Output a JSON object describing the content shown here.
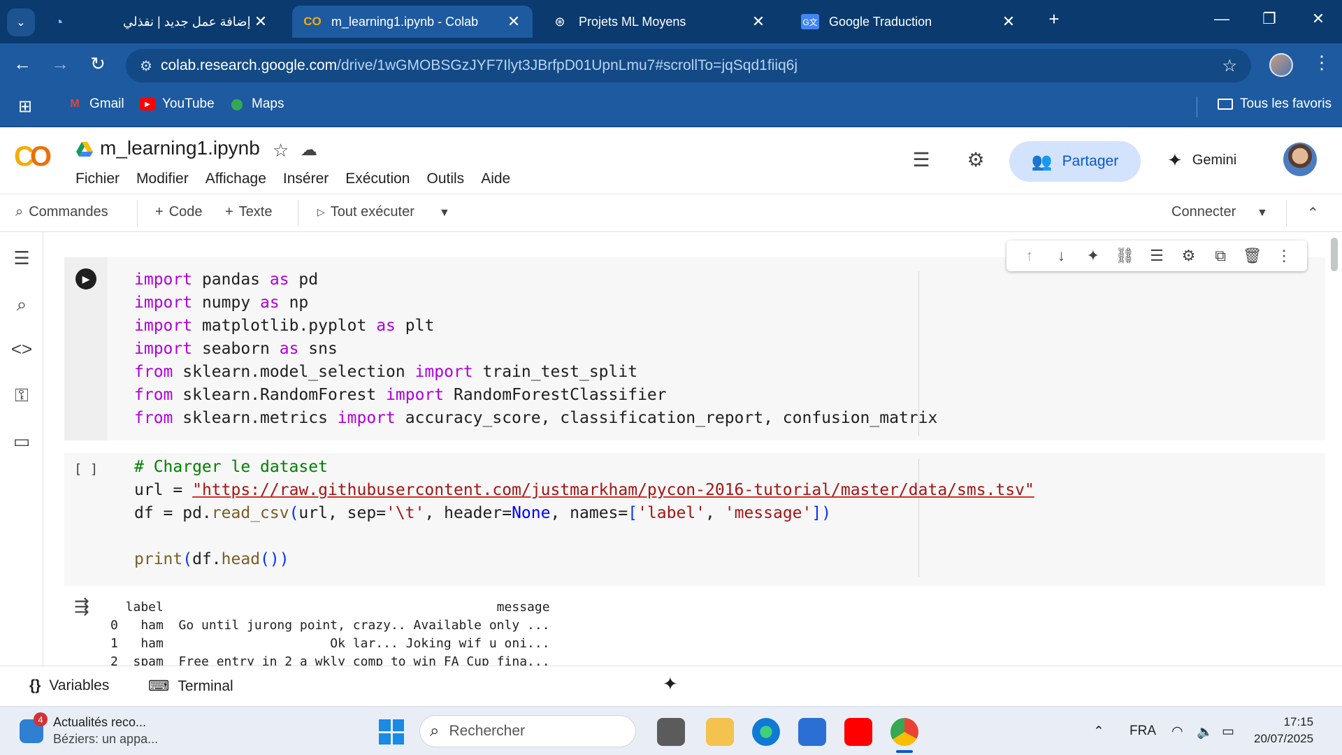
{
  "browser": {
    "tabs": [
      {
        "title": "إضافة عمل جديد | نفذلي",
        "active": false
      },
      {
        "title": "m_learning1.ipynb - Colab",
        "active": true
      },
      {
        "title": "Projets ML Moyens",
        "active": false
      },
      {
        "title": "Google Traduction",
        "active": false
      }
    ],
    "new_tab": "+",
    "url_host": "colab.research.google.com",
    "url_path": "/drive/1wGMOBSGzJYF7Ilyt3JBrfpD01UpnLmu7#scrollTo=jqSqd1fiiq6j",
    "bookmarks": [
      {
        "label": "Gmail"
      },
      {
        "label": "YouTube"
      },
      {
        "label": "Maps"
      }
    ],
    "all_bookmarks": "Tous les favoris"
  },
  "colab": {
    "logo": "CO",
    "title": "m_learning1.ipynb",
    "menu": [
      "Fichier",
      "Modifier",
      "Affichage",
      "Insérer",
      "Exécution",
      "Outils",
      "Aide"
    ],
    "share_label": "Partager",
    "gemini_label": "Gemini",
    "toolbar": {
      "commands": "Commandes",
      "add_code": "Code",
      "add_text": "Texte",
      "run_all": "Tout exécuter",
      "connect": "Connecter"
    },
    "cells": [
      {
        "type": "code",
        "exec_count": "",
        "lines": [
          "import pandas as pd",
          "import numpy as np",
          "import matplotlib.pyplot as plt",
          "import seaborn as sns",
          "from sklearn.model_selection import train_test_split",
          "from sklearn.RandomForest import RandomForestClassifier",
          "from sklearn.metrics import accuracy_score, classification_report, confusion_matrix"
        ]
      },
      {
        "type": "code",
        "exec_count": "[ ]",
        "lines": [
          "# Charger le dataset",
          "url = \"https://raw.githubusercontent.com/justmarkham/pycon-2016-tutorial/master/data/sms.tsv\"",
          "df = pd.read_csv(url, sep='\\t', header=None, names=['label', 'message'])",
          "",
          "print(df.head())"
        ],
        "output": [
          "  label                                            message",
          "0   ham  Go until jurong point, crazy.. Available only ...",
          "1   ham                      Ok lar... Joking wif u oni...",
          "2  spam  Free entry in 2 a wkly comp to win FA Cup fina..."
        ]
      }
    ],
    "bottom_panel": {
      "variables": "Variables",
      "terminal": "Terminal"
    }
  },
  "taskbar": {
    "news_badge": "4",
    "news_title": "Actualités reco...",
    "news_sub": "Béziers: un appa...",
    "search_placeholder": "Rechercher",
    "language": "FRA",
    "time": "17:15",
    "date": "20/07/2025"
  },
  "colors": {
    "tabbar": "#0a3a6e",
    "chrome": "#1d5aa0",
    "share_bg": "#d3e3fd",
    "keyword": "#af00db",
    "string": "#a31515",
    "comment": "#008000"
  }
}
